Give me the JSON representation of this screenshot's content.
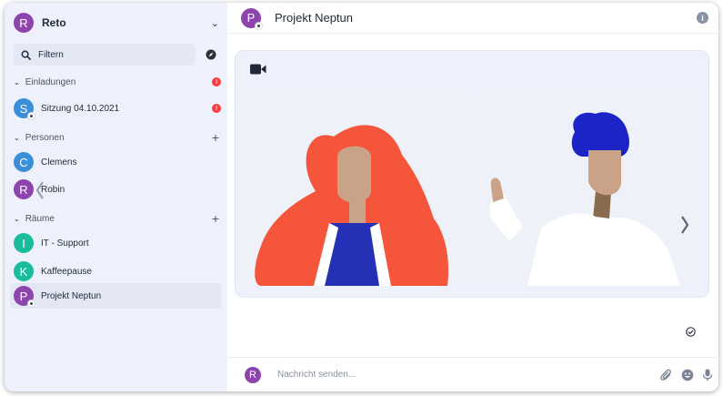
{
  "account": {
    "initial": "R",
    "name": "Reto",
    "color": "#8e44ad"
  },
  "filter": {
    "label": "Filtern"
  },
  "sections": {
    "invitations": {
      "label": "Einladungen",
      "badge": "!"
    },
    "people": {
      "label": "Personen"
    },
    "rooms": {
      "label": "Räume"
    }
  },
  "rooms": {
    "invitation": {
      "initial": "S",
      "name": "Sitzung 04.10.2021",
      "color": "#3b8fd9",
      "badge": "!"
    },
    "clemens": {
      "initial": "C",
      "name": "Clemens",
      "color": "#3b8fd9"
    },
    "robin": {
      "initial": "R",
      "name": "Robin",
      "color": "#8e44ad"
    },
    "it_support": {
      "initial": "I",
      "name": "IT - Support",
      "color": "#1abc9c"
    },
    "kaffeepause": {
      "initial": "K",
      "name": "Kaffeepause",
      "color": "#1abc9c"
    },
    "projekt_neptun": {
      "initial": "P",
      "name": "Projekt Neptun",
      "color": "#8e44ad"
    }
  },
  "header": {
    "initial": "P",
    "title": "Projekt Neptun",
    "info": "i"
  },
  "composer": {
    "initial": "R",
    "placeholder": "Nachricht senden..."
  },
  "icons": [
    "search-icon",
    "compass-icon",
    "video-camera-icon",
    "info-icon",
    "check-circle-icon",
    "paperclip-icon",
    "emoji-icon",
    "microphone-icon",
    "chevron-left-icon",
    "chevron-right-icon"
  ]
}
